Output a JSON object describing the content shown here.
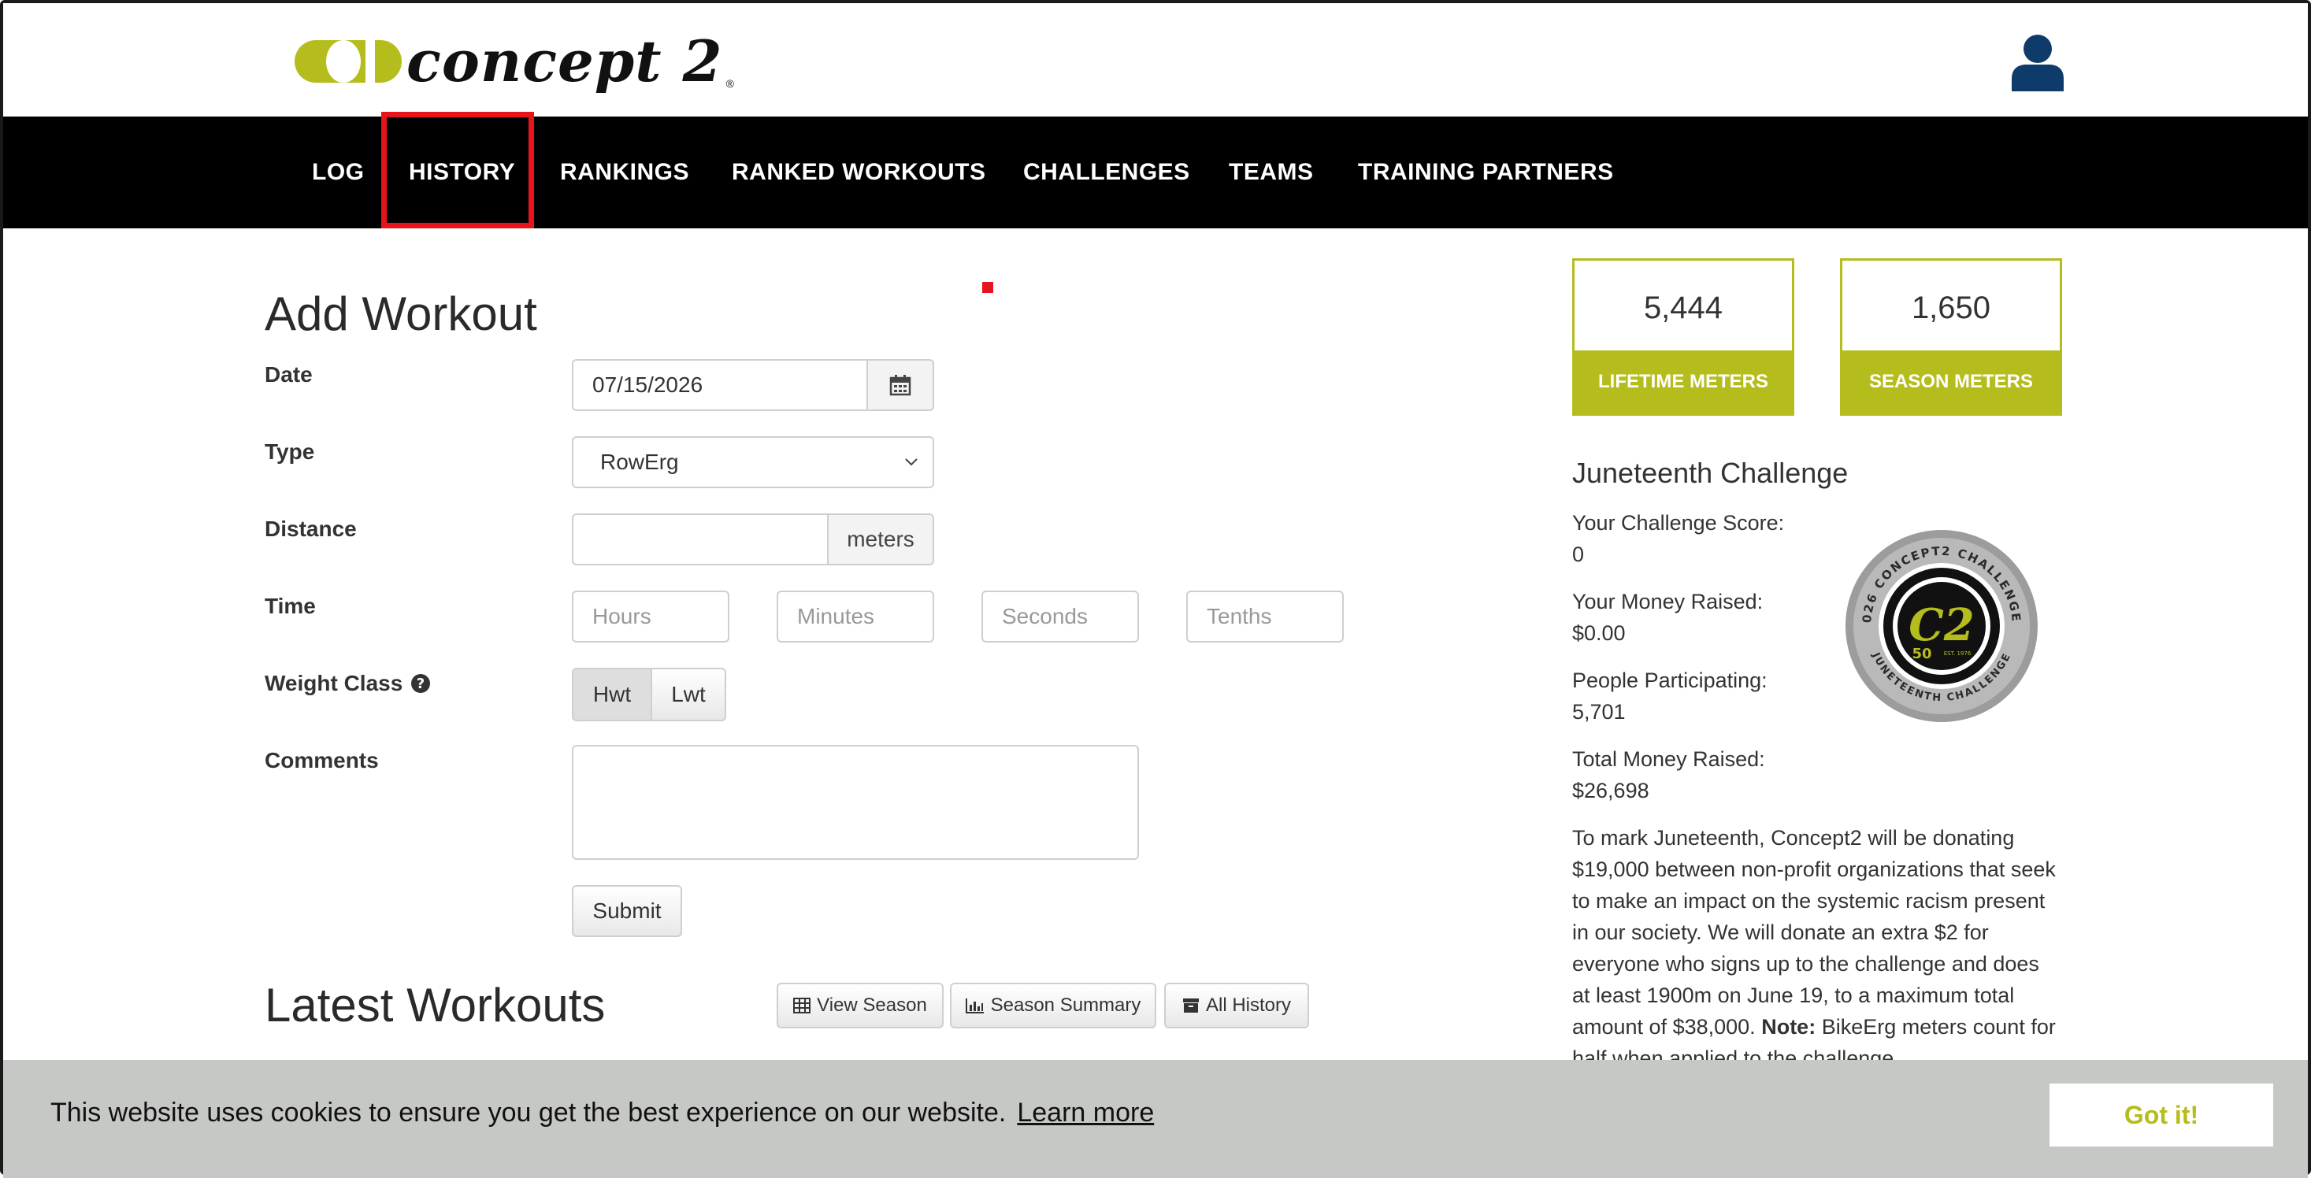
{
  "header": {
    "logo_text": "concept 2",
    "logo_reg": "®"
  },
  "nav": {
    "items": [
      "LOG",
      "HISTORY",
      "RANKINGS",
      "RANKED WORKOUTS",
      "CHALLENGES",
      "TEAMS",
      "TRAINING PARTNERS"
    ]
  },
  "form": {
    "title": "Add Workout",
    "date_label": "Date",
    "date_value": "07/15/2026",
    "type_label": "Type",
    "type_value": "RowErg",
    "distance_label": "Distance",
    "distance_unit": "meters",
    "time_label": "Time",
    "time_placeholders": [
      "Hours",
      "Minutes",
      "Seconds",
      "Tenths"
    ],
    "weight_label": "Weight Class",
    "weight_options": [
      "Hwt",
      "Lwt"
    ],
    "comments_label": "Comments",
    "submit_label": "Submit"
  },
  "latest": {
    "title": "Latest Workouts",
    "view_season": "View Season",
    "season_summary": "Season Summary",
    "all_history": "All History"
  },
  "stats": {
    "lifetime_value": "5,444",
    "lifetime_label": "LIFETIME METERS",
    "season_value": "1,650",
    "season_label": "SEASON METERS"
  },
  "challenge": {
    "title": "Juneteenth Challenge",
    "score_label": "Your Challenge Score:",
    "score_value": "0",
    "money_label": "Your Money Raised:",
    "money_value": "$0.00",
    "people_label": "People Participating:",
    "people_value": "5,701",
    "total_label": "Total Money Raised:",
    "total_value": "$26,698",
    "description": "To mark Juneteenth, Concept2 will be donating $19,000 between non-profit organizations that seek to make an impact on the systemic racism present in our society. We will donate an extra $2 for everyone who signs up to the challenge and does at least 1900m on June 19, to a maximum total amount of $38,000.",
    "note_label": "Note:",
    "note_text": "BikeErg meters count for half when applied to the challenge.",
    "badge_top": "2026 CONCEPT2 CHALLENGES",
    "badge_bottom": "JUNETEENTH CHALLENGE",
    "badge_c2": "C2",
    "badge_50": "50",
    "badge_est": "EST. 1976"
  },
  "cookie": {
    "message": "This website uses cookies to ensure you get the best experience on our website.",
    "learn_more": "Learn more",
    "got_it": "Got it!"
  },
  "colors": {
    "brand": "#b5bd1d",
    "nav_bg": "#000000",
    "highlight": "#e8141c",
    "user_icon": "#0f3b6b"
  }
}
